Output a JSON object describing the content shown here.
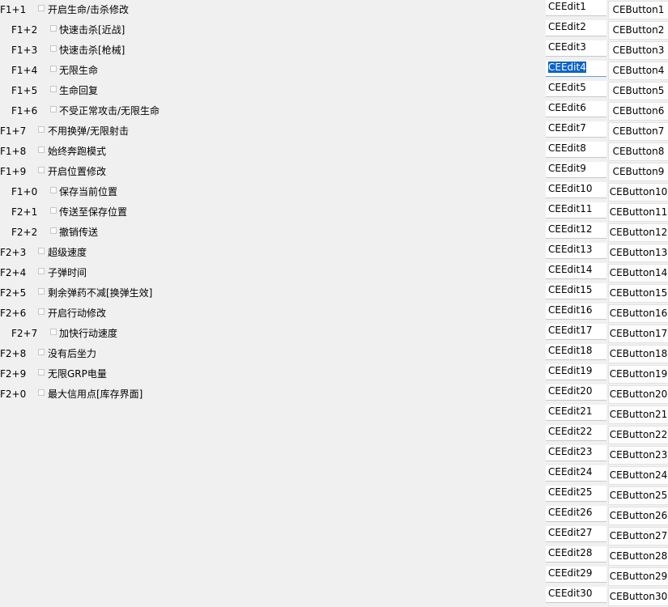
{
  "cheats": [
    {
      "hotkey": "F1+1",
      "label": "开启生命/击杀修改",
      "indent": 0
    },
    {
      "hotkey": "F1+2",
      "label": "快速击杀[近战]",
      "indent": 1
    },
    {
      "hotkey": "F1+3",
      "label": "快速击杀[枪械]",
      "indent": 1
    },
    {
      "hotkey": "F1+4",
      "label": "无限生命",
      "indent": 1
    },
    {
      "hotkey": "F1+5",
      "label": "生命回复",
      "indent": 1
    },
    {
      "hotkey": "F1+6",
      "label": "不受正常攻击/无限生命",
      "indent": 1
    },
    {
      "hotkey": "F1+7",
      "label": "不用换弹/无限射击",
      "indent": 0
    },
    {
      "hotkey": "F1+8",
      "label": "始终奔跑模式",
      "indent": 0
    },
    {
      "hotkey": "F1+9",
      "label": "开启位置修改",
      "indent": 0
    },
    {
      "hotkey": "F1+0",
      "label": "保存当前位置",
      "indent": 1
    },
    {
      "hotkey": "F2+1",
      "label": "传送至保存位置",
      "indent": 1
    },
    {
      "hotkey": "F2+2",
      "label": "撤销传送",
      "indent": 1
    },
    {
      "hotkey": "F2+3",
      "label": "超级速度",
      "indent": 0
    },
    {
      "hotkey": "F2+4",
      "label": "子弹时间",
      "indent": 0
    },
    {
      "hotkey": "F2+5",
      "label": "剩余弹药不减[换弹生效]",
      "indent": 0
    },
    {
      "hotkey": "F2+6",
      "label": "开启行动修改",
      "indent": 0
    },
    {
      "hotkey": "F2+7",
      "label": "加快行动速度",
      "indent": 1
    },
    {
      "hotkey": "F2+8",
      "label": "没有后坐力",
      "indent": 0
    },
    {
      "hotkey": "F2+9",
      "label": "无限GRP电量",
      "indent": 0
    },
    {
      "hotkey": "F2+0",
      "label": "最大信用点[库存界面]",
      "indent": 0
    }
  ],
  "ce_controls": [
    {
      "edit": "CEEdit1",
      "button": "CEButton1"
    },
    {
      "edit": "CEEdit2",
      "button": "CEButton2"
    },
    {
      "edit": "CEEdit3",
      "button": "CEButton3"
    },
    {
      "edit": "CEEdit4",
      "button": "CEButton4",
      "edit_selected": true
    },
    {
      "edit": "CEEdit5",
      "button": "CEButton5"
    },
    {
      "edit": "CEEdit6",
      "button": "CEButton6"
    },
    {
      "edit": "CEEdit7",
      "button": "CEButton7"
    },
    {
      "edit": "CEEdit8",
      "button": "CEButton8"
    },
    {
      "edit": "CEEdit9",
      "button": "CEButton9"
    },
    {
      "edit": "CEEdit10",
      "button": "CEButton10"
    },
    {
      "edit": "CEEdit11",
      "button": "CEButton11"
    },
    {
      "edit": "CEEdit12",
      "button": "CEButton12"
    },
    {
      "edit": "CEEdit13",
      "button": "CEButton13"
    },
    {
      "edit": "CEEdit14",
      "button": "CEButton14"
    },
    {
      "edit": "CEEdit15",
      "button": "CEButton15"
    },
    {
      "edit": "CEEdit16",
      "button": "CEButton16"
    },
    {
      "edit": "CEEdit17",
      "button": "CEButton17"
    },
    {
      "edit": "CEEdit18",
      "button": "CEButton18"
    },
    {
      "edit": "CEEdit19",
      "button": "CEButton19"
    },
    {
      "edit": "CEEdit20",
      "button": "CEButton20"
    },
    {
      "edit": "CEEdit21",
      "button": "CEButton21"
    },
    {
      "edit": "CEEdit22",
      "button": "CEButton22"
    },
    {
      "edit": "CEEdit23",
      "button": "CEButton23"
    },
    {
      "edit": "CEEdit24",
      "button": "CEButton24"
    },
    {
      "edit": "CEEdit25",
      "button": "CEButton25"
    },
    {
      "edit": "CEEdit26",
      "button": "CEButton26"
    },
    {
      "edit": "CEEdit27",
      "button": "CEButton27"
    },
    {
      "edit": "CEEdit28",
      "button": "CEButton28"
    },
    {
      "edit": "CEEdit29",
      "button": "CEButton29"
    },
    {
      "edit": "CEEdit30",
      "button": "CEButton30"
    }
  ],
  "colors": {
    "background": "#f0f0f0",
    "selection": "#0a64c8"
  }
}
